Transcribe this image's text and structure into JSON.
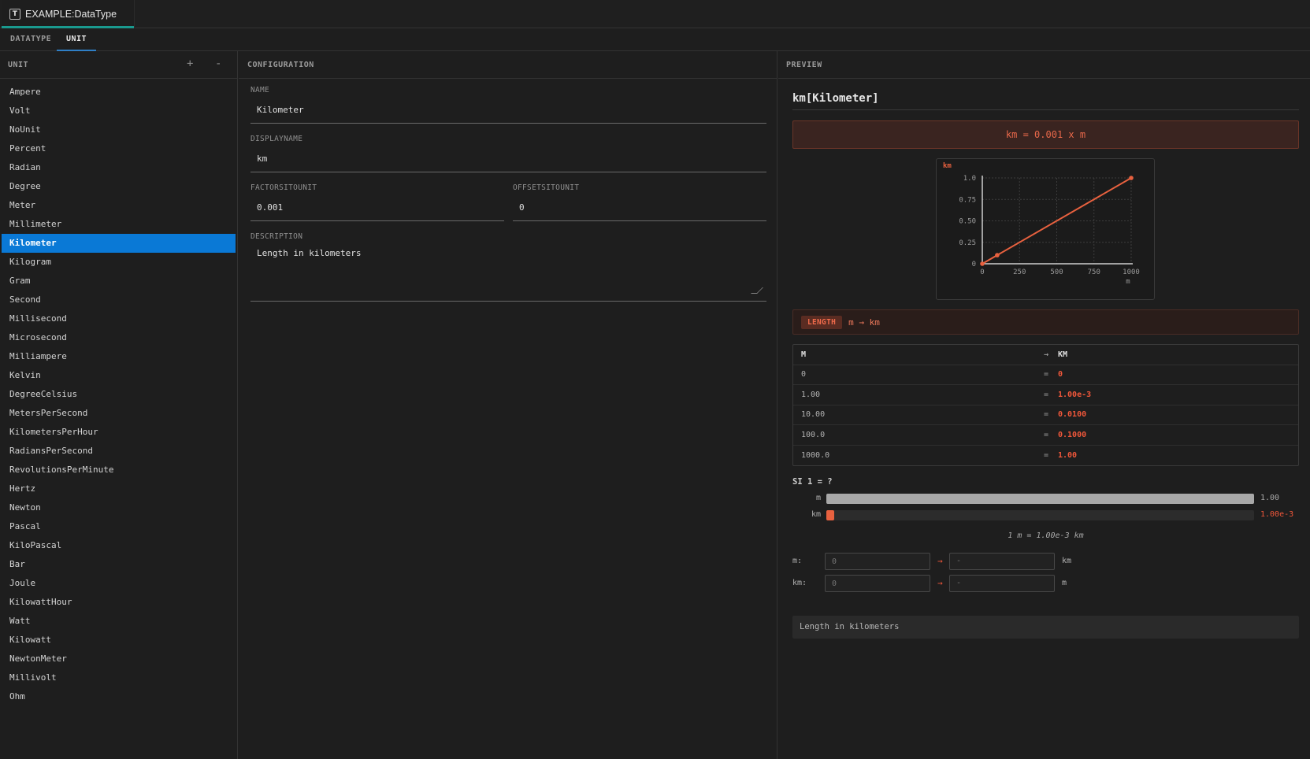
{
  "window": {
    "tab_title": "EXAMPLE:DataType",
    "tab_icon": "text-file-icon"
  },
  "subtabs": [
    {
      "label": "DATATYPE",
      "active": false
    },
    {
      "label": "UNIT",
      "active": true
    }
  ],
  "unit_panel": {
    "header": "UNIT",
    "add_label": "+",
    "remove_label": "-",
    "selected": "Kilometer",
    "items": [
      "Ampere",
      "Volt",
      "NoUnit",
      "Percent",
      "Radian",
      "Degree",
      "Meter",
      "Millimeter",
      "Kilometer",
      "Kilogram",
      "Gram",
      "Second",
      "Millisecond",
      "Microsecond",
      "Milliampere",
      "Kelvin",
      "DegreeCelsius",
      "MetersPerSecond",
      "KilometersPerHour",
      "RadiansPerSecond",
      "RevolutionsPerMinute",
      "Hertz",
      "Newton",
      "Pascal",
      "KiloPascal",
      "Bar",
      "Joule",
      "KilowattHour",
      "Watt",
      "Kilowatt",
      "NewtonMeter",
      "Millivolt",
      "Ohm"
    ]
  },
  "configuration": {
    "header": "CONFIGURATION",
    "name": {
      "label": "NAME",
      "value": "Kilometer"
    },
    "displayname": {
      "label": "DISPLAYNAME",
      "value": "km"
    },
    "factor": {
      "label": "FACTORSITOUNIT",
      "value": "0.001"
    },
    "offset": {
      "label": "OFFSETSITOUNIT",
      "value": "0"
    },
    "description": {
      "label": "DESCRIPTION",
      "value": "Length in kilometers"
    }
  },
  "preview": {
    "header": "PREVIEW",
    "title": "km[Kilometer]",
    "formula": "km = 0.001 x m",
    "category": {
      "badge": "LENGTH",
      "conversion": "m → km"
    },
    "table": {
      "header_from": "M",
      "header_op": "→",
      "header_to": "KM",
      "rows": [
        {
          "from": "0",
          "op": "=",
          "to": "0"
        },
        {
          "from": "1.00",
          "op": "=",
          "to": "1.00e-3"
        },
        {
          "from": "10.00",
          "op": "=",
          "to": "0.0100"
        },
        {
          "from": "100.0",
          "op": "=",
          "to": "0.1000"
        },
        {
          "from": "1000.0",
          "op": "=",
          "to": "1.00"
        }
      ]
    },
    "si_compare": {
      "label": "SI 1 = ?",
      "rows": [
        {
          "unit": "m",
          "value": "1.00",
          "fraction": 1.0,
          "color": "#a8a8a8",
          "value_color": "#a8a8a8"
        },
        {
          "unit": "km",
          "value": "1.00e-3",
          "fraction": 0.001,
          "color": "#e8613f",
          "value_color": "#f0573a"
        }
      ],
      "note": "1 m = 1.00e-3 km"
    },
    "converters": [
      {
        "label": "m:",
        "input_placeholder": "0",
        "output": "-",
        "unit": "km"
      },
      {
        "label": "km:",
        "input_placeholder": "0",
        "output": "-",
        "unit": "m"
      }
    ],
    "description": "Length in kilometers"
  },
  "colors": {
    "accent": "#e8613f",
    "selection": "#0a79d6",
    "tab_indicator": "#1a9a8f"
  },
  "chart_data": {
    "type": "line",
    "title": "",
    "ylabel": "km",
    "xlabel": "m",
    "x_ticks": [
      "0",
      "250",
      "500",
      "750",
      "1000"
    ],
    "y_ticks": [
      "0",
      "0.25",
      "0.50",
      "0.75",
      "1.0"
    ],
    "xlim": [
      0,
      1000
    ],
    "ylim": [
      0,
      1
    ],
    "grid": true,
    "series": [
      {
        "x": [
          0,
          1000
        ],
        "y": [
          0,
          1
        ]
      }
    ],
    "markers": [
      {
        "x": 0,
        "y": 0
      },
      {
        "x": 100,
        "y": 0.1
      },
      {
        "x": 1000,
        "y": 1
      }
    ]
  }
}
